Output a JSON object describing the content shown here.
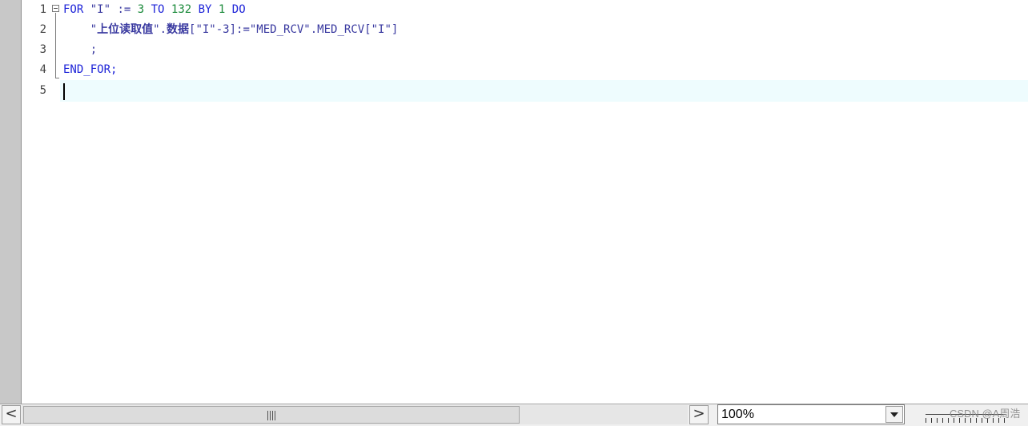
{
  "editor": {
    "line_numbers": [
      "1",
      "2",
      "3",
      "4",
      "5"
    ],
    "lines": [
      [
        {
          "t": "FOR ",
          "c": "kw"
        },
        {
          "t": "\"I\"",
          "c": "str"
        },
        {
          "t": " := ",
          "c": "str"
        },
        {
          "t": "3",
          "c": "num"
        },
        {
          "t": " TO ",
          "c": "kw"
        },
        {
          "t": "132",
          "c": "num"
        },
        {
          "t": " BY ",
          "c": "kw"
        },
        {
          "t": "1",
          "c": "num"
        },
        {
          "t": " DO",
          "c": "kw"
        }
      ],
      [
        {
          "t": "    \"",
          "c": "str"
        },
        {
          "t": "上位读取值",
          "c": "cn"
        },
        {
          "t": "\".",
          "c": "str"
        },
        {
          "t": "数据",
          "c": "cn"
        },
        {
          "t": "[\"I\"-3]:=\"MED_RCV\".MED_RCV[\"I\"]",
          "c": "str"
        }
      ],
      [
        {
          "t": "    ;",
          "c": "str"
        }
      ],
      [
        {
          "t": "END_FOR;",
          "c": "kw"
        }
      ],
      []
    ]
  },
  "statusbar": {
    "zoom_value": "100%",
    "scroll_left_glyph": "<",
    "scroll_right_glyph": ">",
    "thumb_grip_glyph": "III",
    "watermark": "CSDN @A周浩"
  }
}
